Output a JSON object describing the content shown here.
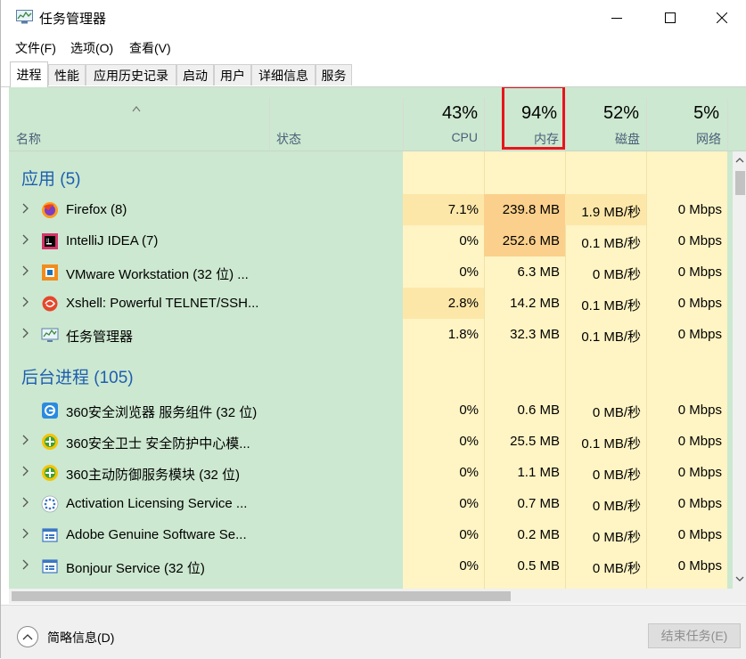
{
  "window": {
    "title": "任务管理器"
  },
  "menu": [
    "文件(F)",
    "选项(O)",
    "查看(V)"
  ],
  "tabs": [
    "进程",
    "性能",
    "应用历史记录",
    "启动",
    "用户",
    "详细信息",
    "服务"
  ],
  "header": {
    "name_label": "名称",
    "status_label": "状态",
    "cpu": {
      "pct": "43%",
      "label": "CPU"
    },
    "mem": {
      "pct": "94%",
      "label": "内存"
    },
    "disk": {
      "pct": "52%",
      "label": "磁盘"
    },
    "net": {
      "pct": "5%",
      "label": "网络"
    }
  },
  "groups": {
    "apps": "应用 (5)",
    "background": "后台进程 (105)"
  },
  "apps": [
    {
      "name": "Firefox (8)",
      "cpu": "7.1%",
      "mem": "239.8 MB",
      "disk": "1.9 MB/秒",
      "net": "0 Mbps",
      "icon": "firefox-icon"
    },
    {
      "name": "IntelliJ IDEA (7)",
      "cpu": "0%",
      "mem": "252.6 MB",
      "disk": "0.1 MB/秒",
      "net": "0 Mbps",
      "icon": "intellij-icon"
    },
    {
      "name": "VMware Workstation (32 位) ...",
      "cpu": "0%",
      "mem": "6.3 MB",
      "disk": "0 MB/秒",
      "net": "0 Mbps",
      "icon": "vmware-icon"
    },
    {
      "name": "Xshell: Powerful TELNET/SSH...",
      "cpu": "2.8%",
      "mem": "14.2 MB",
      "disk": "0.1 MB/秒",
      "net": "0 Mbps",
      "icon": "xshell-icon"
    },
    {
      "name": "任务管理器",
      "cpu": "1.8%",
      "mem": "32.3 MB",
      "disk": "0.1 MB/秒",
      "net": "0 Mbps",
      "icon": "task-manager-icon"
    }
  ],
  "background": [
    {
      "name": "360安全浏览器 服务组件 (32 位)",
      "cpu": "0%",
      "mem": "0.6 MB",
      "disk": "0 MB/秒",
      "net": "0 Mbps",
      "icon": "360-browser-icon"
    },
    {
      "name": "360安全卫士 安全防护中心模...",
      "cpu": "0%",
      "mem": "25.5 MB",
      "disk": "0.1 MB/秒",
      "net": "0 Mbps",
      "icon": "360-safe-icon"
    },
    {
      "name": "360主动防御服务模块 (32 位)",
      "cpu": "0%",
      "mem": "1.1 MB",
      "disk": "0 MB/秒",
      "net": "0 Mbps",
      "icon": "360-defense-icon"
    },
    {
      "name": "Activation Licensing Service ...",
      "cpu": "0%",
      "mem": "0.7 MB",
      "disk": "0 MB/秒",
      "net": "0 Mbps",
      "icon": "service-dots-icon"
    },
    {
      "name": "Adobe Genuine Software Se...",
      "cpu": "0%",
      "mem": "0.2 MB",
      "disk": "0 MB/秒",
      "net": "0 Mbps",
      "icon": "service-window-icon"
    },
    {
      "name": "Bonjour Service (32 位)",
      "cpu": "0%",
      "mem": "0.5 MB",
      "disk": "0 MB/秒",
      "net": "0 Mbps",
      "icon": "service-window-icon"
    }
  ],
  "footer": {
    "brief": "简略信息(D)",
    "end_task": "结束任务(E)"
  },
  "colors": {
    "accent_group": "#1e5eb1",
    "highlight_box": "#e8141c",
    "heat_low": "#fff4c4",
    "heat_mid": "#fde3a0",
    "heat_high": "#fbd08c"
  }
}
